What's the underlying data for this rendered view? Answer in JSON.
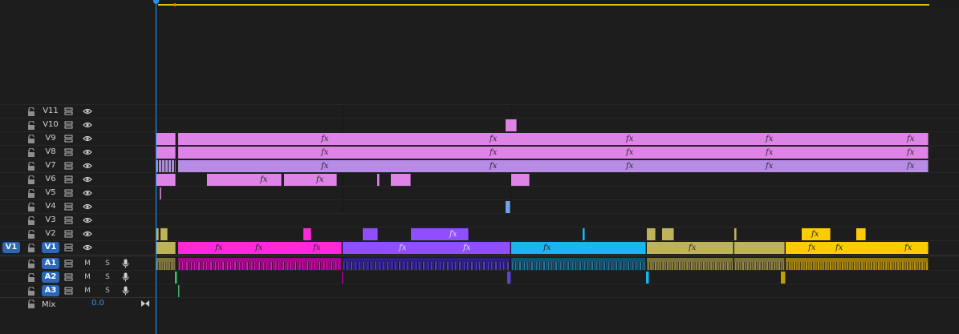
{
  "timeline": {
    "video_tracks": [
      "V11",
      "V10",
      "V9",
      "V8",
      "V7",
      "V6",
      "V5",
      "V4",
      "V3",
      "V2",
      "V1"
    ],
    "source_patch": "V1",
    "audio_tracks": [
      "A1",
      "A2",
      "A3"
    ],
    "mute_label": "M",
    "solo_label": "S",
    "mix_label": "Mix",
    "mix_value": "0.0",
    "fx_label": "fx",
    "colors": {
      "background": "#1d1d1d",
      "playhead": "#2d8ceb",
      "work_area": "#d8c500",
      "target_blue": "#2a68b8",
      "lavender": "#dd84e6",
      "lavender_dark": "#c28cf0",
      "magenta": "#ff29d9",
      "violet": "#8f4fff",
      "cyan": "#1bb6f0",
      "olive": "#bfb35a",
      "gold": "#ffcc00",
      "audio_magenta": "#a8008f",
      "audio_indigo": "#2d1e8a",
      "audio_teal": "#0a5675",
      "audio_olive": "#7d7332",
      "audio_gold": "#9d7b00"
    },
    "icons": {
      "lock": "lock-icon",
      "sync": "sync-lock-icon",
      "eye": "eye-icon",
      "mic": "microphone-icon",
      "mix_end": "bowtie-icon"
    }
  }
}
